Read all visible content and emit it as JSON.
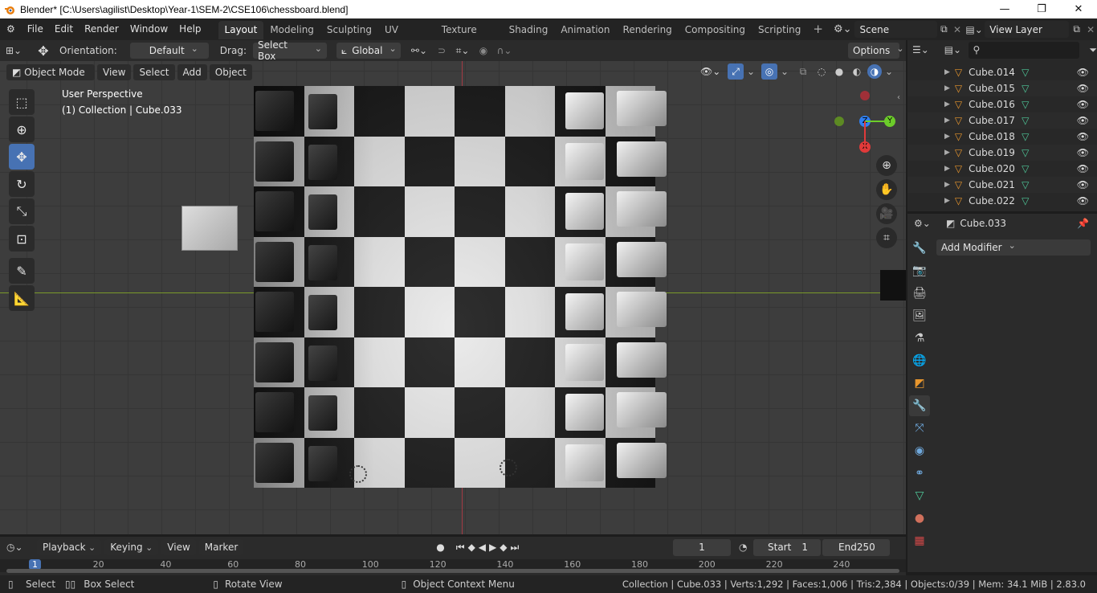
{
  "window": {
    "title": "Blender* [C:\\Users\\agilist\\Desktop\\Year-1\\SEM-2\\CSE106\\chessboard.blend]",
    "minimize": "—",
    "maximize": "❐",
    "close": "✕"
  },
  "menu": {
    "items": [
      "File",
      "Edit",
      "Render",
      "Window",
      "Help"
    ],
    "workspaces": [
      "Layout",
      "Modeling",
      "Sculpting",
      "UV Editing",
      "Texture Paint",
      "Shading",
      "Animation",
      "Rendering",
      "Compositing",
      "Scripting"
    ],
    "active_workspace": "Layout",
    "scene": "Scene",
    "view_layer": "View Layer"
  },
  "header": {
    "orientation_label": "Orientation:",
    "orientation_value": "Default",
    "drag_label": "Drag:",
    "drag_value": "Select Box",
    "transform_orientation": "Global",
    "options": "Options"
  },
  "viewport": {
    "mode": "Object Mode",
    "menus": [
      "View",
      "Select",
      "Add",
      "Object"
    ],
    "perspective": "User Perspective",
    "collection_info": "(1) Collection | Cube.033",
    "gizmo_axes": {
      "z": "Z",
      "y": "Y",
      "x": "X"
    }
  },
  "outliner": {
    "items": [
      "Cube.014",
      "Cube.015",
      "Cube.016",
      "Cube.017",
      "Cube.018",
      "Cube.019",
      "Cube.020",
      "Cube.021",
      "Cube.022"
    ]
  },
  "properties": {
    "object_name": "Cube.033",
    "add_modifier": "Add Modifier"
  },
  "timeline": {
    "menus": [
      "Playback",
      "Keying",
      "View",
      "Marker"
    ],
    "current_frame": "1",
    "start_label": "Start",
    "start_value": "1",
    "end_label": "End",
    "end_value": "250",
    "ruler": [
      "1",
      "20",
      "40",
      "60",
      "80",
      "100",
      "120",
      "140",
      "160",
      "180",
      "200",
      "220",
      "240"
    ]
  },
  "statusbar": {
    "select": "Select",
    "box_select": "Box Select",
    "rotate_view": "Rotate View",
    "context_menu": "Object Context Menu",
    "stats": "Collection | Cube.033 | Verts:1,292 | Faces:1,006 | Tris:2,384 | Objects:0/39 | Mem: 34.1 MiB | 2.83.0"
  },
  "colors": {
    "accent": "#4772b3",
    "x_axis": "#e03a3a",
    "y_axis": "#6ccc2a",
    "z_axis": "#2f7ff0",
    "mesh_icon": "#e8962d",
    "data_icon": "#4fc99a"
  }
}
